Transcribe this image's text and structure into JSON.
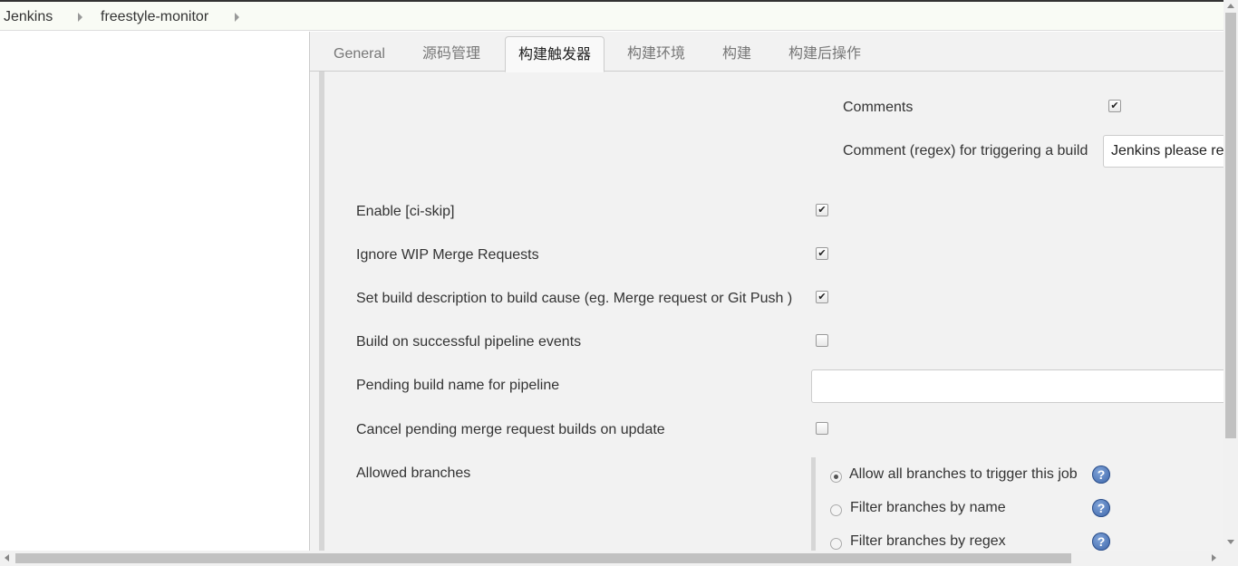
{
  "breadcrumb": {
    "items": [
      "Jenkins",
      "freestyle-monitor"
    ]
  },
  "tabs": [
    {
      "label": "General",
      "active": false
    },
    {
      "label": "源码管理",
      "active": false
    },
    {
      "label": "构建触发器",
      "active": true
    },
    {
      "label": "构建环境",
      "active": false
    },
    {
      "label": "构建",
      "active": false
    },
    {
      "label": "构建后操作",
      "active": false
    }
  ],
  "form": {
    "comments_label": "Comments",
    "comments_checked": true,
    "comment_regex_label": "Comment (regex) for triggering a build",
    "comment_regex_value": "Jenkins please retry a build",
    "ci_skip_label": "Enable [ci-skip]",
    "ci_skip_checked": true,
    "ignore_wip_label": "Ignore WIP Merge Requests",
    "ignore_wip_checked": true,
    "set_desc_label": "Set build description to build cause (eg. Merge request or Git Push )",
    "set_desc_checked": true,
    "pipeline_events_label": "Build on successful pipeline events",
    "pipeline_events_checked": false,
    "pending_name_label": "Pending build name for pipeline",
    "pending_name_value": "",
    "cancel_pending_label": "Cancel pending merge request builds on update",
    "cancel_pending_checked": false,
    "allowed_branches_label": "Allowed branches",
    "branch_options": [
      {
        "label": "Allow all branches to trigger this job",
        "checked": true
      },
      {
        "label": "Filter branches by name",
        "checked": false
      },
      {
        "label": "Filter branches by regex",
        "checked": false
      }
    ]
  },
  "icons": {
    "check": "✔",
    "help": "?"
  }
}
